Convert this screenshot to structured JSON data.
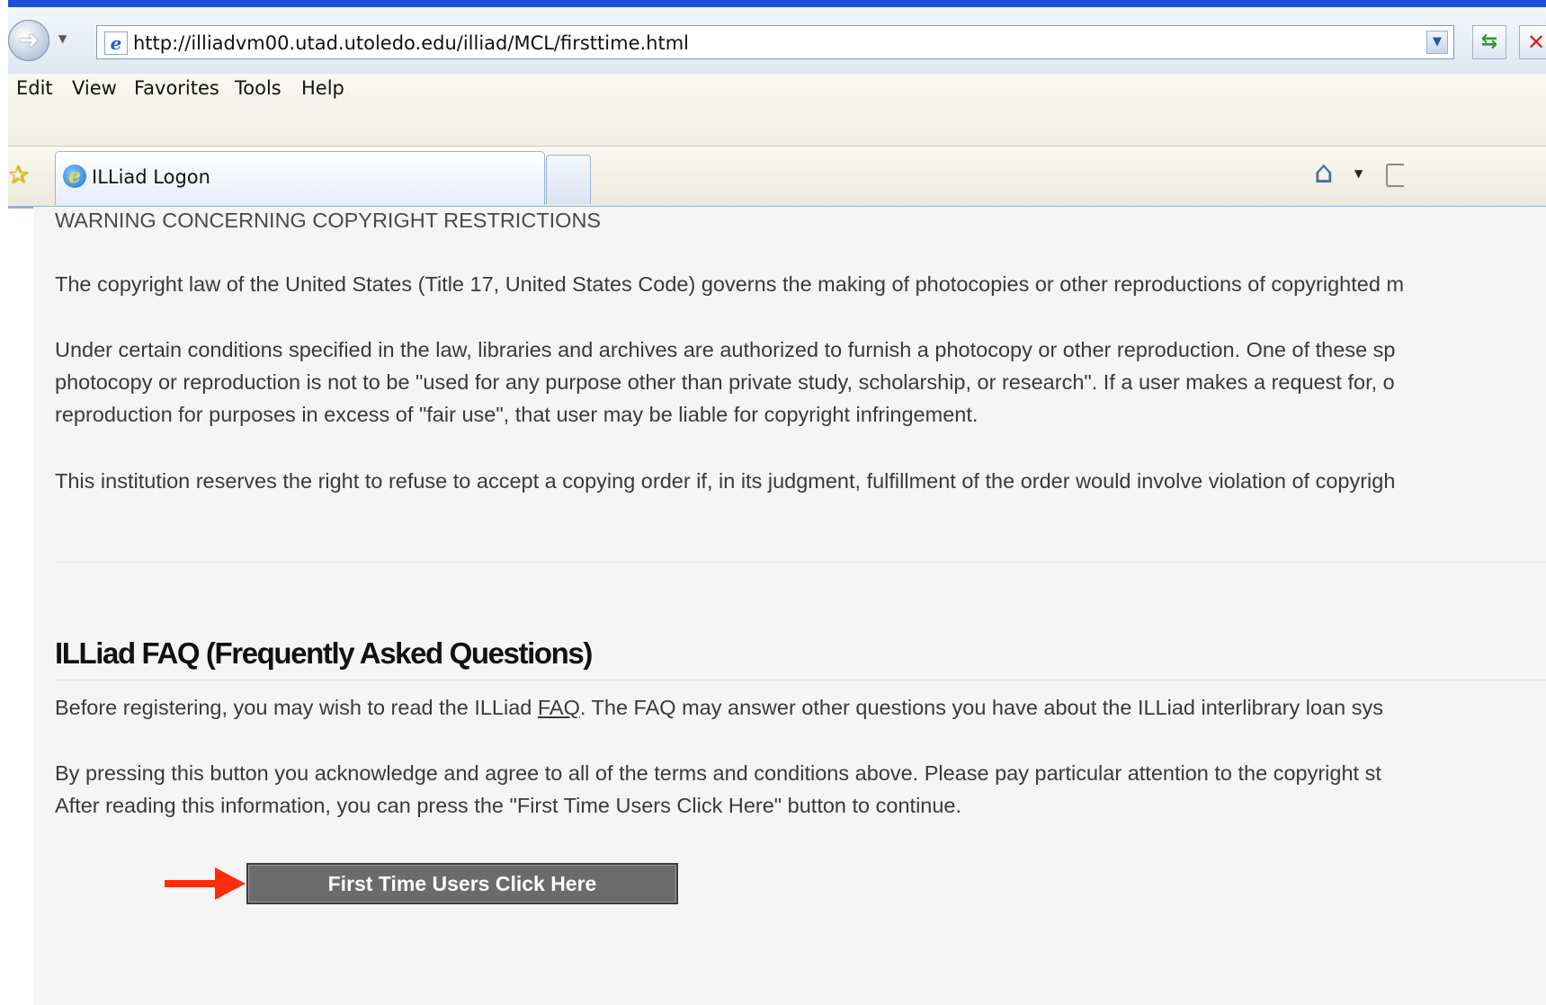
{
  "browser": {
    "url": "http://illiadvm00.utad.utoledo.edu/illiad/MCL/firsttime.html",
    "menu": [
      "Edit",
      "View",
      "Favorites",
      "Tools",
      "Help"
    ],
    "tab_title": "ILLiad Logon",
    "icons": {
      "back": "back-arrow-icon",
      "ie": "ie-page-icon",
      "refresh": "refresh-icon",
      "stop": "stop-icon",
      "favorites": "favorites-star-icon",
      "home": "home-icon",
      "feeds": "feeds-icon"
    },
    "colors": {
      "titlebar": "#1e4fd6",
      "tab_border": "#9bb0cc"
    }
  },
  "page": {
    "warning_heading": "WARNING CONCERNING COPYRIGHT RESTRICTIONS",
    "copyright_para": "The copyright law of the United States (Title 17, United States Code) governs the making of photocopies or other reproductions of copyrighted m",
    "conditions_lines": [
      "Under certain conditions specified in the law, libraries and archives are authorized to furnish a photocopy or other reproduction. One of these sp",
      "photocopy or reproduction is not to be \"used for any purpose other than private study, scholarship, or research\". If a user makes a request for, o",
      "reproduction for purposes in excess of \"fair use\", that user may be liable for copyright infringement."
    ],
    "institution_para": "This institution reserves the right to refuse to accept a copying order if, in its judgment, fulfillment of the order would involve violation of copyrigh",
    "faq_heading": "ILLiad FAQ (Frequently Asked Questions)",
    "faq_before": "Before registering, you may wish to read the ILLiad ",
    "faq_link": "FAQ",
    "faq_after": ". The FAQ may answer other questions you have about the ILLiad interlibrary loan sys",
    "ack_lines": [
      "By pressing this button you acknowledge and agree to all of the terms and conditions above. Please pay particular attention to the copyright st",
      "After reading this information, you can press the \"First Time Users Click Here\" button to continue."
    ],
    "button_label": "First Time Users Click Here",
    "colors": {
      "arrow": "#ff2c0a",
      "button": "#6b6b6b",
      "background": "#f5f5f5"
    }
  }
}
